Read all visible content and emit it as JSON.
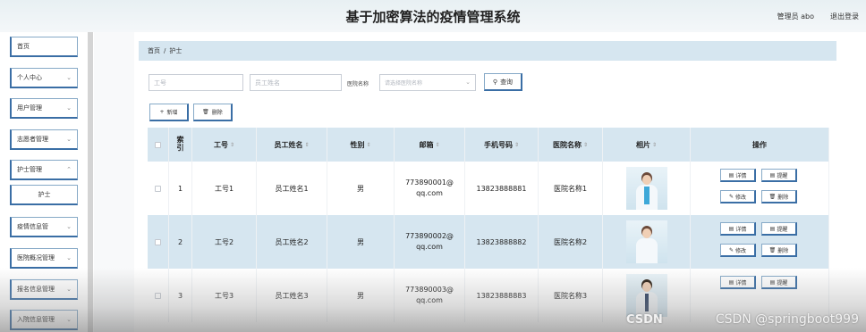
{
  "header": {
    "title": "基于加密算法的疫情管理系统",
    "admin_label": "管理员 abo",
    "logout_label": "退出登录"
  },
  "sidebar": {
    "items": [
      {
        "label": "首页"
      },
      {
        "label": "个人中心"
      },
      {
        "label": "用户管理"
      },
      {
        "label": "志愿者管理"
      },
      {
        "label": "护士管理"
      },
      {
        "label": "护士"
      },
      {
        "label": "疫情信息管"
      },
      {
        "label": "医院概况管理"
      },
      {
        "label": "报名信息管理"
      },
      {
        "label": "入院信息管理"
      }
    ]
  },
  "breadcrumb": {
    "home": "首页",
    "separator": "/",
    "current": "护士"
  },
  "search": {
    "job_number_placeholder": "工号",
    "employee_name_placeholder": "员工姓名",
    "hospital_label": "医院名称",
    "hospital_placeholder": "请选择医院名称",
    "query_label": "查询"
  },
  "actions": {
    "add_label": "新增",
    "delete_label": "删除"
  },
  "table": {
    "columns": {
      "index": "索引",
      "job_number": "工号",
      "employee_name": "员工姓名",
      "gender": "性别",
      "email": "邮箱",
      "phone": "手机号码",
      "hospital": "医院名称",
      "photo": "相片",
      "operation": "操作"
    },
    "rows": [
      {
        "index": "1",
        "job_number": "工号1",
        "employee_name": "员工姓名1",
        "gender": "男",
        "email": "773890001@qq.com",
        "phone": "13823888881",
        "hospital": "医院名称1"
      },
      {
        "index": "2",
        "job_number": "工号2",
        "employee_name": "员工姓名2",
        "gender": "男",
        "email": "773890002@qq.com",
        "phone": "13823888882",
        "hospital": "医院名称2"
      },
      {
        "index": "3",
        "job_number": "工号3",
        "employee_name": "员工姓名3",
        "gender": "男",
        "email": "773890003@qq.com",
        "phone": "13823888883",
        "hospital": "医院名称3"
      }
    ],
    "row_buttons": {
      "detail": "详情",
      "remind": "提醒",
      "edit": "修改",
      "delete": "删除"
    }
  },
  "watermark": {
    "logo": "CSDN",
    "text": "CSDN @springboot999"
  },
  "colors": {
    "accent": "#3a6ea5",
    "header_row_bg": "#d6e6f0",
    "breadcrumb_bg": "#d6e6f0"
  }
}
